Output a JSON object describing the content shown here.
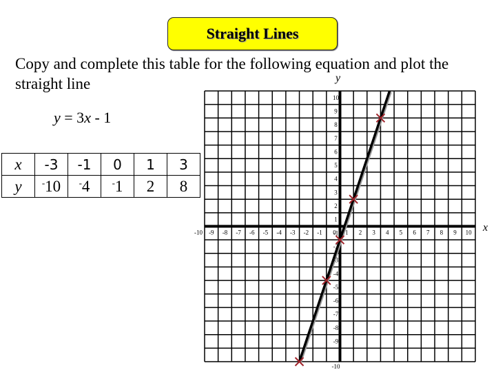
{
  "header": {
    "title": "Straight Lines",
    "instruction": "Copy and complete this table for the following equation and plot the straight line"
  },
  "equation": {
    "lhs": "y",
    "equals": " = 3",
    "var": "x",
    "rest": " - 1"
  },
  "table": {
    "x_header": "x",
    "y_header": "y",
    "x_values": [
      "-3",
      "-1",
      "0",
      "1",
      "3"
    ],
    "y_values": [
      {
        "sign": "-",
        "num": "10"
      },
      {
        "sign": "-",
        "num": "4"
      },
      {
        "sign": "-",
        "num": "1"
      },
      {
        "sign": "",
        "num": "2"
      },
      {
        "sign": "",
        "num": "8"
      }
    ]
  },
  "colors": {
    "title_bg": "#ffff00",
    "grid": "#000000",
    "line": "#000000",
    "marker": "#a0232a"
  },
  "chart_data": {
    "type": "line",
    "title": "y = 3x - 1",
    "xlabel": "x",
    "ylabel": "y",
    "xlim": [
      -10,
      10
    ],
    "ylim": [
      -10,
      10
    ],
    "grid": true,
    "x_ticks": [
      -10,
      -9,
      -8,
      -7,
      -6,
      -5,
      -4,
      -3,
      -2,
      -1,
      0,
      1,
      2,
      3,
      4,
      5,
      6,
      7,
      8,
      9,
      10
    ],
    "y_ticks": [
      -10,
      -9,
      -8,
      -7,
      -6,
      -5,
      -4,
      -3,
      -2,
      -1,
      1,
      2,
      3,
      4,
      5,
      6,
      7,
      8,
      9,
      10
    ],
    "series": [
      {
        "name": "y = 3x - 1",
        "x": [
          -3,
          3.667
        ],
        "y": [
          -10,
          10
        ]
      }
    ],
    "points": [
      {
        "x": -3,
        "y": -10
      },
      {
        "x": -1,
        "y": -4
      },
      {
        "x": 0,
        "y": -1
      },
      {
        "x": 1,
        "y": 2
      },
      {
        "x": 3,
        "y": 8
      }
    ]
  }
}
